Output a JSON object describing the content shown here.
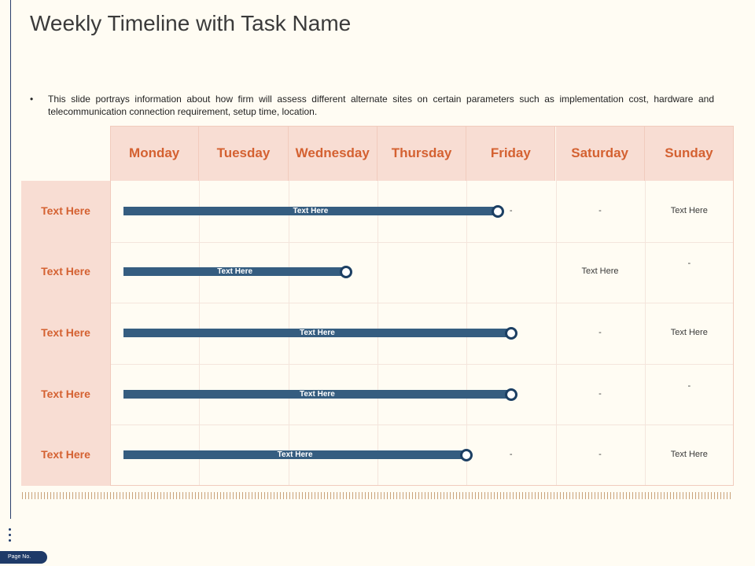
{
  "title": "Weekly Timeline with Task Name",
  "description": "This slide portrays information about how firm will assess different alternate sites on certain parameters such as implementation cost, hardware and telecommunication connection requirement, setup time, location.",
  "bullet_symbol": "•",
  "days": [
    "Monday",
    "Tuesday",
    "Wednesday",
    "Thursday",
    "Friday",
    "Saturday",
    "Sunday"
  ],
  "tasks": [
    {
      "label": "Text Here",
      "bar_label": "Text Here",
      "bar_end_day_fraction": 4.35,
      "cells": [
        "-",
        "-",
        "Text Here"
      ]
    },
    {
      "label": "Text Here",
      "bar_label": "Text Here",
      "bar_end_day_fraction": 2.65,
      "cells": [
        "Text Here",
        "-"
      ]
    },
    {
      "label": "Text Here",
      "bar_label": "Text Here",
      "bar_end_day_fraction": 4.5,
      "cells": [
        "-",
        "Text Here"
      ]
    },
    {
      "label": "Text Here",
      "bar_label": "Text Here",
      "bar_end_day_fraction": 4.5,
      "cells": [
        "-",
        "-"
      ]
    },
    {
      "label": "Text Here",
      "bar_label": "Text Here",
      "bar_end_day_fraction": 4.0,
      "cells": [
        "-",
        "-",
        "Text Here"
      ]
    }
  ],
  "footer": {
    "page_label": "Page No."
  },
  "colors": {
    "accent": "#d46131",
    "header_bg": "#f8ddd3",
    "bar": "#355d80",
    "page_bg": "#fffcf3"
  }
}
